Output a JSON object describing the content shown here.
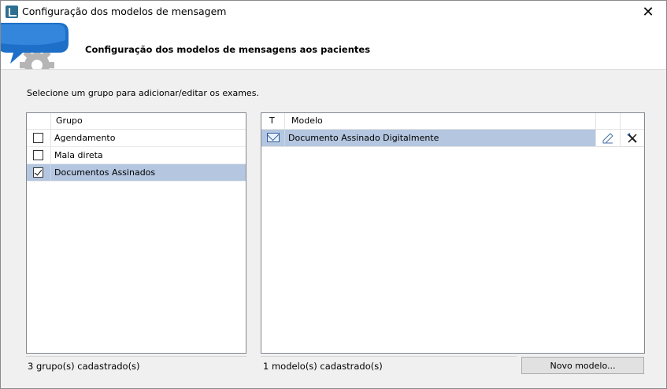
{
  "window": {
    "title": "Configuração dos modelos de mensagem",
    "close_glyph": "✕"
  },
  "header": {
    "title": "Configuração dos modelos de mensagens aos pacientes"
  },
  "instruction": "Selecione um grupo para adicionar/editar os exames.",
  "groups": {
    "column_header": "Grupo",
    "items": [
      {
        "label": "Agendamento",
        "checked": false
      },
      {
        "label": "Mala direta",
        "checked": false
      },
      {
        "label": "Documentos Assinados",
        "checked": true,
        "selected": true
      }
    ],
    "status": "3 grupo(s) cadastrado(s)"
  },
  "models": {
    "column_type": "T",
    "column_model": "Modelo",
    "items": [
      {
        "type_icon": "mail-icon",
        "label": "Documento Assinado Digitalmente",
        "selected": true
      }
    ],
    "status": "1 modelo(s) cadastrado(s)",
    "new_button": "Novo modelo..."
  },
  "colors": {
    "selection": "#b4c6e0",
    "logo_blue": "#2a7fd4",
    "logo_gear": "#b8b8b8"
  }
}
